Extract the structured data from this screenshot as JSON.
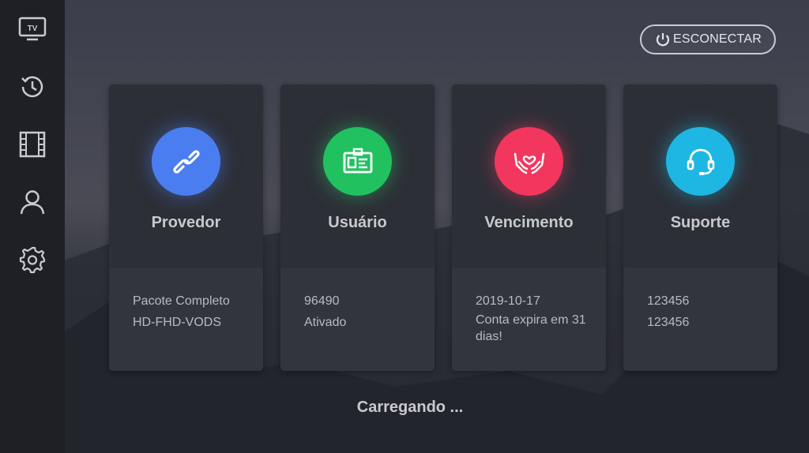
{
  "sidebar": {
    "items": [
      {
        "name": "tv",
        "icon": "tv-icon",
        "label": "TV"
      },
      {
        "name": "history",
        "icon": "history-icon"
      },
      {
        "name": "movies",
        "icon": "film-icon"
      },
      {
        "name": "account",
        "icon": "user-icon"
      },
      {
        "name": "settings",
        "icon": "gear-icon"
      }
    ]
  },
  "header": {
    "disconnect_label": "ESCONECTAR",
    "disconnect_icon": "power-icon"
  },
  "cards": [
    {
      "title": "Provedor",
      "icon": "link-icon",
      "color": "#4a7ef0",
      "lines": [
        "Pacote Completo",
        "HD-FHD-VODS"
      ]
    },
    {
      "title": "Usuário",
      "icon": "id-card-icon",
      "color": "#22c160",
      "lines": [
        "96490",
        "Ativado"
      ]
    },
    {
      "title": "Vencimento",
      "icon": "heart-hands-icon",
      "color": "#f2365e",
      "lines": [
        "2019-10-17",
        "Conta expira em 31 dias!"
      ]
    },
    {
      "title": "Suporte",
      "icon": "headset-icon",
      "color": "#1eb7e3",
      "lines": [
        "123456",
        "123456"
      ]
    }
  ],
  "status": {
    "loading_text": "Carregando ..."
  }
}
